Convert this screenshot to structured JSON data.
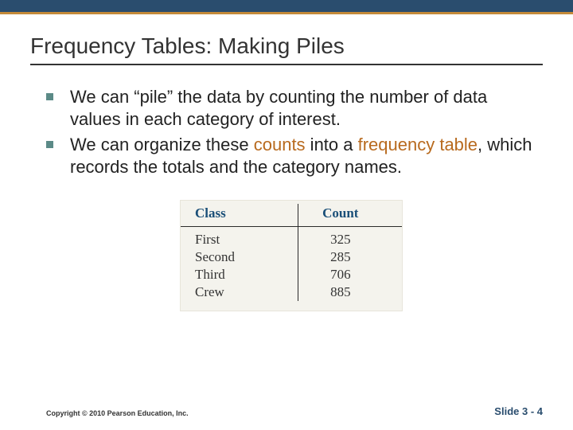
{
  "title": "Frequency Tables: Making Piles",
  "bullets": [
    {
      "pre": "We can “pile” the data by counting the number of data values in each category of interest."
    },
    {
      "pre": "We can organize these ",
      "hl1": "counts",
      "mid": " into a ",
      "hl2": "frequency table",
      "post": ", which records the totals and the category names."
    }
  ],
  "chart_data": {
    "type": "table",
    "title": "",
    "columns": [
      "Class",
      "Count"
    ],
    "rows": [
      {
        "class": "First",
        "count": 325
      },
      {
        "class": "Second",
        "count": 285
      },
      {
        "class": "Third",
        "count": 706
      },
      {
        "class": "Crew",
        "count": 885
      }
    ]
  },
  "footer": {
    "copyright": "Copyright © 2010 Pearson Education, Inc.",
    "slide": "Slide 3 - 4"
  }
}
